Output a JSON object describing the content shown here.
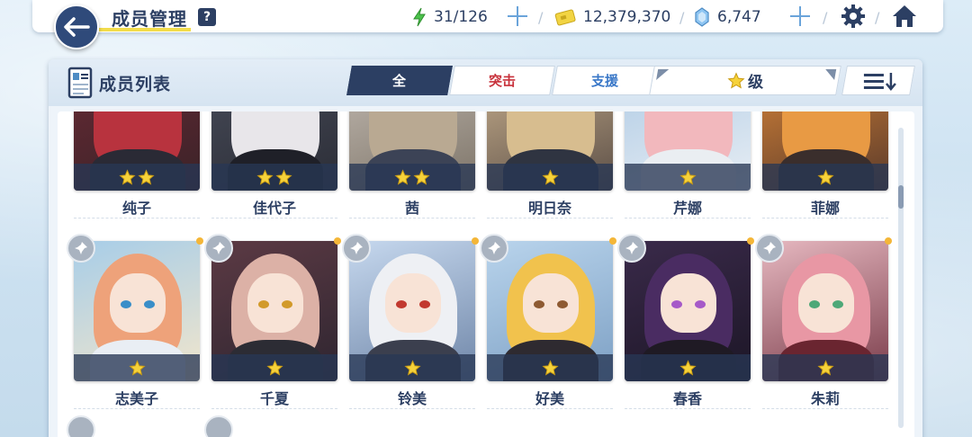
{
  "header": {
    "title": "成员管理",
    "help_label": "?",
    "ap": "31/126",
    "credits": "12,379,370",
    "pyroxene": "6,747",
    "colors": {
      "accent": "#2c3f63",
      "ap": "#4cc24c",
      "credit": "#f2d443",
      "pyroxene": "#8ec5f2"
    }
  },
  "panel": {
    "title": "成员列表",
    "tabs": [
      {
        "label": "全"
      },
      {
        "label": "突击"
      },
      {
        "label": "支援"
      }
    ],
    "filter_label": "级",
    "sort_icon": "sort-list-icon"
  },
  "row1": [
    {
      "name": "纯子",
      "stars": 2
    },
    {
      "name": "佳代子",
      "stars": 2
    },
    {
      "name": "茜",
      "stars": 2
    },
    {
      "name": "明日奈",
      "stars": 1
    },
    {
      "name": "芹娜",
      "stars": 1
    },
    {
      "name": "菲娜",
      "stars": 1
    }
  ],
  "row2": [
    {
      "name": "志美子",
      "stars": 1
    },
    {
      "name": "千夏",
      "stars": 1
    },
    {
      "name": "铃美",
      "stars": 1
    },
    {
      "name": "好美",
      "stars": 1
    },
    {
      "name": "春香",
      "stars": 1
    },
    {
      "name": "朱莉",
      "stars": 1
    }
  ]
}
